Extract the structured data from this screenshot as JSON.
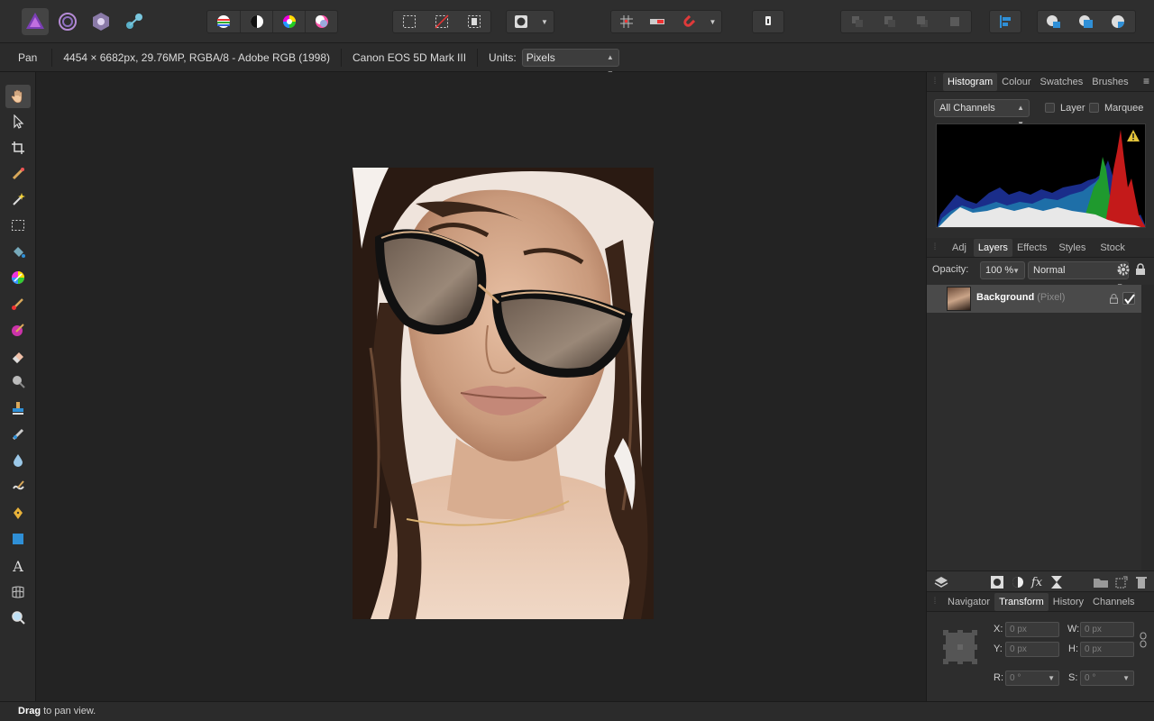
{
  "context": {
    "tool_name": "Pan",
    "doc_info": "4454 × 6682px, 29.76MP, RGBA/8 - Adobe RGB (1998)",
    "camera": "Canon EOS 5D Mark III",
    "units_label": "Units:",
    "units_value": "Pixels"
  },
  "status": {
    "bold": "Drag",
    "rest": " to pan view."
  },
  "histogram_panel": {
    "tabs": [
      "Histogram",
      "Colour",
      "Swatches",
      "Brushes"
    ],
    "channel_select": "All Channels",
    "layer_label": "Layer",
    "marquee_label": "Marquee"
  },
  "layers_panel": {
    "tabs": [
      "Adj",
      "Layers",
      "Effects",
      "Styles",
      "Stock"
    ],
    "opacity_label": "Opacity:",
    "opacity_value": "100 %",
    "blend_mode": "Normal",
    "layer_name": "Background",
    "layer_type": "(Pixel)"
  },
  "transform_panel": {
    "tabs": [
      "Navigator",
      "Transform",
      "History",
      "Channels"
    ],
    "x_label": "X:",
    "x_value": "0 px",
    "y_label": "Y:",
    "y_value": "0 px",
    "w_label": "W:",
    "w_value": "0 px",
    "h_label": "H:",
    "h_value": "0 px",
    "r_label": "R:",
    "r_value": "0 °",
    "s_label": "S:",
    "s_value": "0 °"
  },
  "colors": {
    "accent_blue": "#2f8fd6",
    "active_tool_bg": "#474747",
    "warning_yellow": "#e3c43a"
  }
}
